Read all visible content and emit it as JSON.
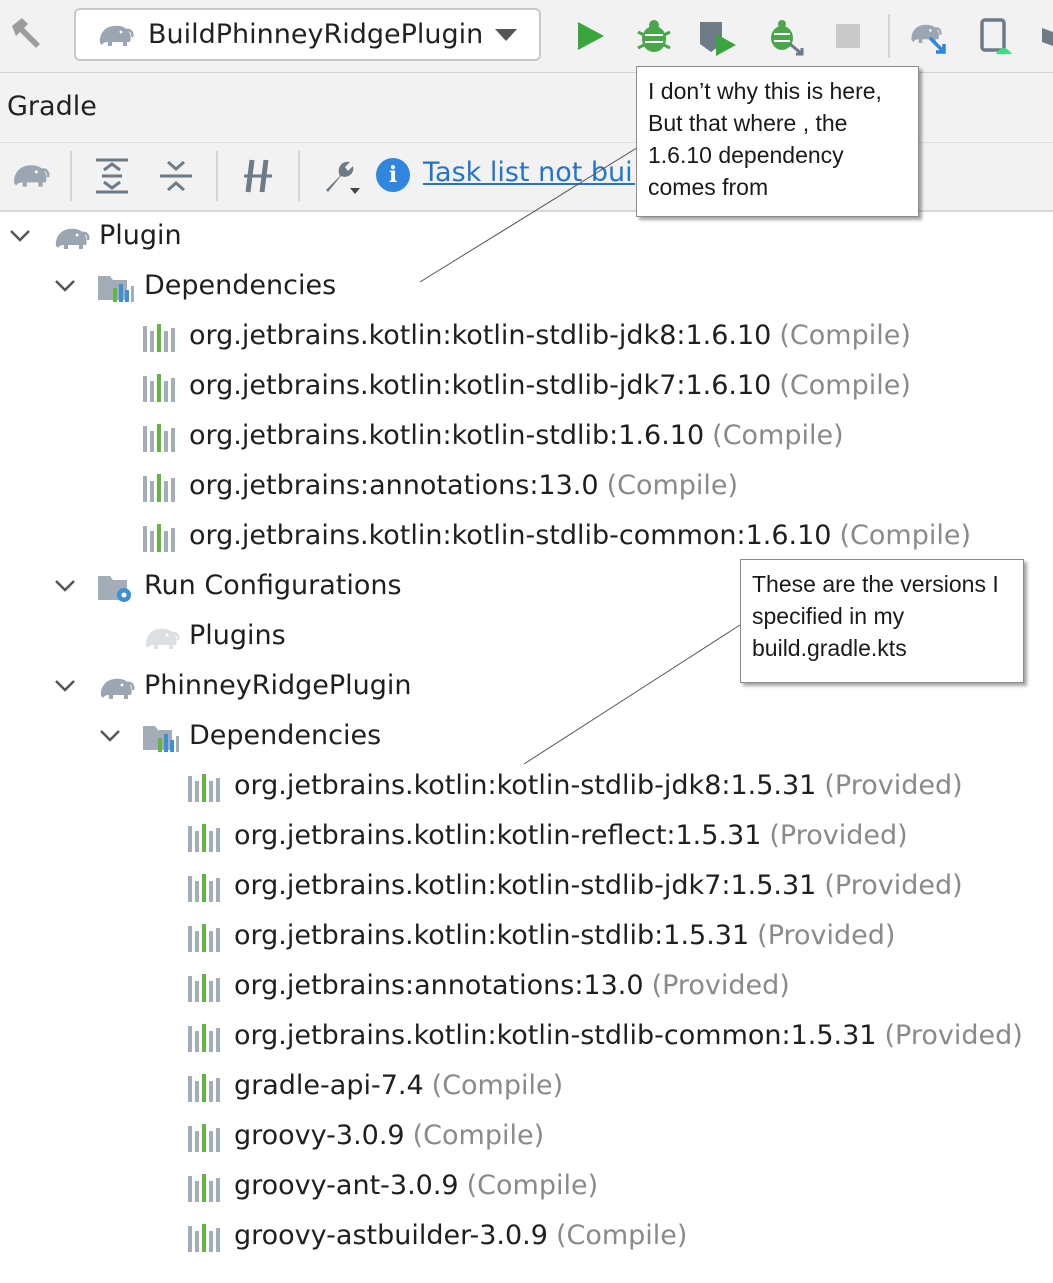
{
  "toolbar": {
    "run_config": "BuildPhinneyRidgePlugin",
    "icons": [
      "build-icon",
      "run-icon",
      "debug-icon",
      "coverage-icon",
      "attach-debugger-icon",
      "stop-icon",
      "gradle-sync-icon",
      "device-manager-icon"
    ]
  },
  "panel": {
    "title": "Gradle"
  },
  "gradle_toolbar": {
    "task_list_link": "Task list not buil"
  },
  "tree": [
    {
      "level": 0,
      "expanded": true,
      "icon": "gradle-elephant-icon",
      "label": "Plugin",
      "scope": ""
    },
    {
      "level": 1,
      "expanded": true,
      "icon": "dependencies-folder-icon",
      "label": "Dependencies",
      "scope": ""
    },
    {
      "level": 2,
      "icon": "library-icon",
      "label": "org.jetbrains.kotlin:kotlin-stdlib-jdk8:1.6.10",
      "scope": "(Compile)"
    },
    {
      "level": 2,
      "icon": "library-icon",
      "label": "org.jetbrains.kotlin:kotlin-stdlib-jdk7:1.6.10",
      "scope": "(Compile)"
    },
    {
      "level": 2,
      "icon": "library-icon",
      "label": "org.jetbrains.kotlin:kotlin-stdlib:1.6.10",
      "scope": "(Compile)"
    },
    {
      "level": 2,
      "icon": "library-icon",
      "label": "org.jetbrains:annotations:13.0",
      "scope": "(Compile)"
    },
    {
      "level": 2,
      "icon": "library-icon",
      "label": "org.jetbrains.kotlin:kotlin-stdlib-common:1.6.10",
      "scope": "(Compile)"
    },
    {
      "level": 1,
      "expanded": true,
      "icon": "run-configurations-folder-icon",
      "label": "Run Configurations",
      "scope": ""
    },
    {
      "level": 2,
      "icon": "gradle-task-icon",
      "label": "Plugins",
      "scope": ""
    },
    {
      "level": 1,
      "expanded": true,
      "icon": "gradle-elephant-icon",
      "label": "PhinneyRidgePlugin",
      "scope": ""
    },
    {
      "level": 2,
      "expanded": true,
      "icon": "dependencies-folder-icon",
      "label": "Dependencies",
      "scope": ""
    },
    {
      "level": 3,
      "icon": "library-icon",
      "label": "org.jetbrains.kotlin:kotlin-stdlib-jdk8:1.5.31",
      "scope": "(Provided)"
    },
    {
      "level": 3,
      "icon": "library-icon",
      "label": "org.jetbrains.kotlin:kotlin-reflect:1.5.31",
      "scope": "(Provided)"
    },
    {
      "level": 3,
      "icon": "library-icon",
      "label": "org.jetbrains.kotlin:kotlin-stdlib-jdk7:1.5.31",
      "scope": "(Provided)"
    },
    {
      "level": 3,
      "icon": "library-icon",
      "label": "org.jetbrains.kotlin:kotlin-stdlib:1.5.31",
      "scope": "(Provided)"
    },
    {
      "level": 3,
      "icon": "library-icon",
      "label": "org.jetbrains:annotations:13.0",
      "scope": "(Provided)"
    },
    {
      "level": 3,
      "icon": "library-icon",
      "label": "org.jetbrains.kotlin:kotlin-stdlib-common:1.5.31",
      "scope": "(Provided)"
    },
    {
      "level": 3,
      "icon": "library-icon",
      "label": "gradle-api-7.4",
      "scope": "(Compile)"
    },
    {
      "level": 3,
      "icon": "library-icon",
      "label": "groovy-3.0.9",
      "scope": "(Compile)"
    },
    {
      "level": 3,
      "icon": "library-icon",
      "label": "groovy-ant-3.0.9",
      "scope": "(Compile)"
    },
    {
      "level": 3,
      "icon": "library-icon",
      "label": "groovy-astbuilder-3.0.9",
      "scope": "(Compile)"
    }
  ],
  "callouts": {
    "first": [
      "I don’t why this is here,",
      "But that where , the",
      "1.6.10 dependency",
      "comes from"
    ],
    "second": [
      "These are the versions I",
      "specified in my",
      "build.gradle.kts"
    ]
  },
  "colors": {
    "run_green": "#3aa53c",
    "debug_green": "#4aa64a",
    "link_blue": "#2674c8",
    "scope_gray": "#8a8a8a",
    "elephant_gray": "#9aa7b2"
  }
}
